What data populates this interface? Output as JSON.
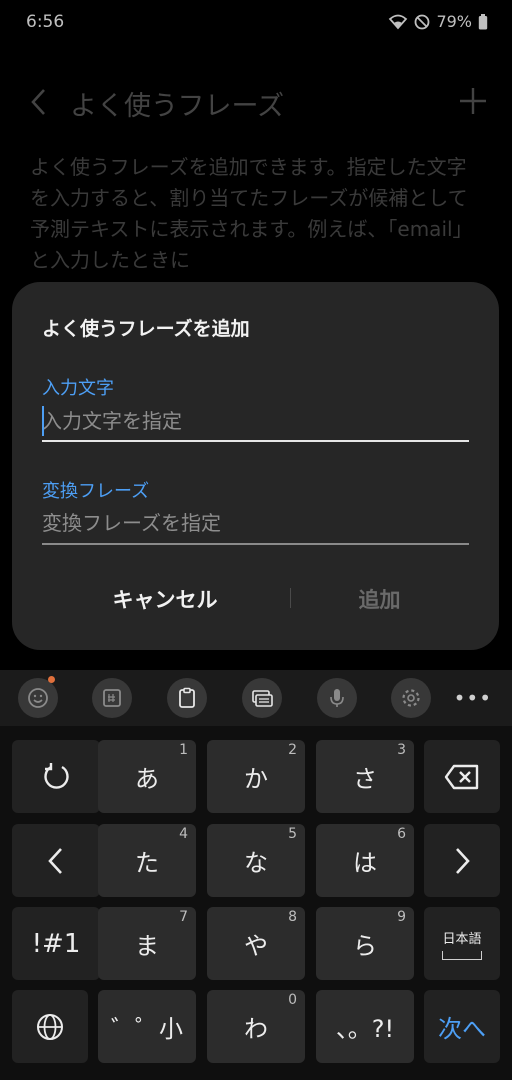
{
  "status": {
    "time": "6:56",
    "battery": "79%"
  },
  "app": {
    "title": "よく使うフレーズ"
  },
  "description": "よく使うフレーズを追加できます。指定した文字を入力すると、割り当てたフレーズが候補として予測テキストに表示されます。例えば、「email」と入力したときに",
  "dialog": {
    "title": "よく使うフレーズを追加",
    "field1_label": "入力文字",
    "field1_placeholder": "入力文字を指定",
    "field2_label": "変換フレーズ",
    "field2_placeholder": "変換フレーズを指定",
    "cancel": "キャンセル",
    "add": "追加"
  },
  "keyboard": {
    "toolbar_icons": [
      "emoji-icon",
      "sticker-icon",
      "clipboard-icon",
      "keyboard-mode-icon",
      "mic-icon",
      "gear-icon"
    ],
    "more": "•••",
    "rows": [
      [
        {
          "label": ""
        },
        {
          "label": "あ",
          "num": "1"
        },
        {
          "label": "か",
          "num": "2"
        },
        {
          "label": "さ",
          "num": "3"
        },
        {
          "label": ""
        }
      ],
      [
        {
          "label": "<"
        },
        {
          "label": "た",
          "num": "4"
        },
        {
          "label": "な",
          "num": "5"
        },
        {
          "label": "は",
          "num": "6"
        },
        {
          "label": ">"
        }
      ],
      [
        {
          "label": "!#1"
        },
        {
          "label": "ま",
          "num": "7"
        },
        {
          "label": "や",
          "num": "8"
        },
        {
          "label": "ら",
          "num": "9"
        },
        {
          "label": "日本語"
        }
      ],
      [
        {
          "label": ""
        },
        {
          "label": "゛゜小"
        },
        {
          "label": "わ",
          "num": "0"
        },
        {
          "label": "、。?!"
        },
        {
          "label": "次へ"
        }
      ]
    ]
  },
  "colors": {
    "accent": "#4d9ff5",
    "dialog_bg": "#262626",
    "key_bg": "#2c2c2c"
  }
}
